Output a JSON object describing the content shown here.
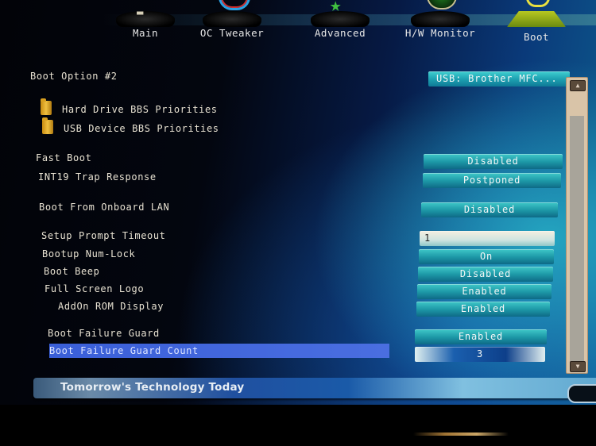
{
  "nav": {
    "tabs": [
      {
        "label": "Main",
        "icon": "main-icon"
      },
      {
        "label": "OC Tweaker",
        "icon": "oc-tweaker-icon"
      },
      {
        "label": "Advanced",
        "icon": "advanced-star-icon"
      },
      {
        "label": "H/W Monitor",
        "icon": "hw-monitor-radar-icon"
      },
      {
        "label": "Boot",
        "icon": "boot-icon",
        "active": true
      }
    ]
  },
  "settings": {
    "boot_option": {
      "label": "Boot Option #2",
      "value": "USB: Brother MFC..."
    },
    "submenus": [
      {
        "label": "Hard Drive BBS Priorities",
        "icon": "folder-icon"
      },
      {
        "label": "USB Device BBS Priorities",
        "icon": "folder-icon"
      }
    ],
    "fast_boot": {
      "label": "Fast Boot",
      "value": "Disabled"
    },
    "int19": {
      "label": "INT19 Trap Response",
      "value": "Postponed"
    },
    "onboard_lan": {
      "label": "Boot From Onboard LAN",
      "value": "Disabled"
    },
    "setup_timeout": {
      "label": "Setup Prompt Timeout",
      "value": "1"
    },
    "numlock": {
      "label": "Bootup Num-Lock",
      "value": "On"
    },
    "beep": {
      "label": "Boot Beep",
      "value": "Disabled"
    },
    "logo": {
      "label": "Full Screen Logo",
      "value": "Enabled"
    },
    "addon_rom": {
      "label": "AddOn ROM Display",
      "value": "Enabled"
    },
    "fail_guard": {
      "label": "Boot Failure Guard",
      "value": "Enabled"
    },
    "fail_guard_count": {
      "label": "Boot Failure Guard Count",
      "value": "3",
      "selected": true
    }
  },
  "scrollbar": {
    "up": "▲",
    "down": "▼"
  },
  "footer": {
    "slogan": "Tomorrow's Technology Today"
  },
  "colors": {
    "selection": "#4266dc",
    "value_button": "#1e9aa8",
    "label_text": "#e8e2d2"
  }
}
